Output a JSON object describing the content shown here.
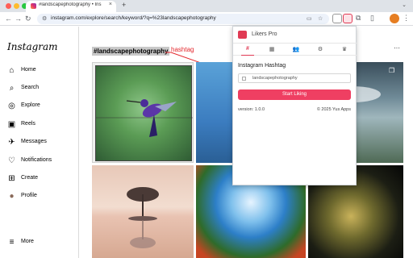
{
  "browser": {
    "tab_title": "#landscapephotography • Ins",
    "tab_close": "×",
    "new_tab": "+",
    "tab_dropdown": "⌄",
    "url": "instagram.com/explore/search/keyword/?q=%23landscapephotography",
    "nav": {
      "back": "←",
      "forward": "→",
      "reload": "↻"
    },
    "colors": {
      "traffic_red": "#ff5f57",
      "traffic_yellow": "#febc2e",
      "traffic_green": "#28c840"
    }
  },
  "sidebar": {
    "logo": "Instagram",
    "items": [
      {
        "label": "Home",
        "icon": "⌂"
      },
      {
        "label": "Search",
        "icon": "⌕"
      },
      {
        "label": "Explore",
        "icon": "◎"
      },
      {
        "label": "Reels",
        "icon": "▣"
      },
      {
        "label": "Messages",
        "icon": "✈"
      },
      {
        "label": "Notifications",
        "icon": "♡"
      },
      {
        "label": "Create",
        "icon": "⊞"
      },
      {
        "label": "Profile",
        "icon": "●"
      }
    ],
    "more": {
      "label": "More",
      "icon": "≡"
    }
  },
  "main": {
    "hashtag": "#landscapephotography",
    "annotation": "hashtag",
    "more_dots": "···"
  },
  "popup": {
    "title": "Likers Pro",
    "tabs": [
      "#",
      "▦",
      "👥",
      "⚙",
      "♛"
    ],
    "section_label": "Instagram Hashtag",
    "input_value": "landscapephotography",
    "button_label": "Start Liking",
    "version": "version: 1.0.0",
    "copyright": "© 2025 Yus Apps",
    "accent": "#ef3f62"
  }
}
